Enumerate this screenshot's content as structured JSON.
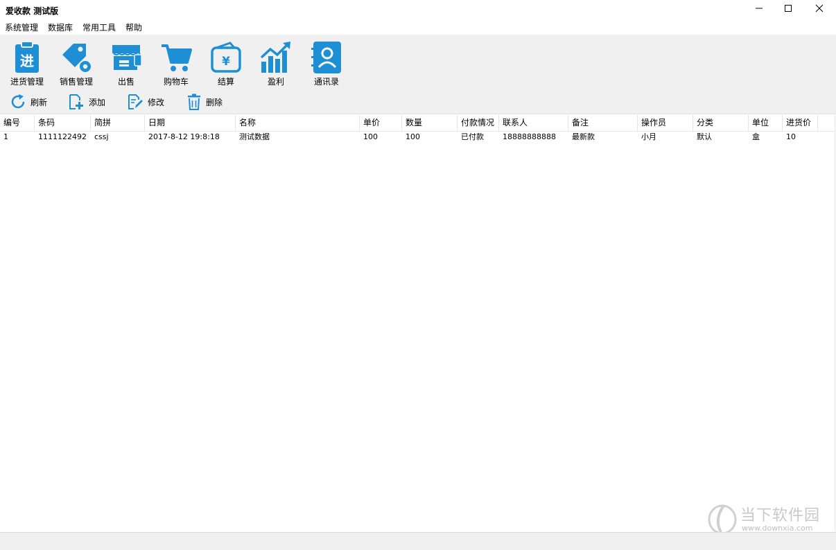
{
  "window": {
    "title": "爱收款 测试版",
    "controls": [
      "minimize",
      "maximize",
      "close"
    ]
  },
  "menu": [
    "系统管理",
    "数据库",
    "常用工具",
    "帮助"
  ],
  "toolbar": {
    "big": [
      {
        "label": "进货管理",
        "icon": "clipboard-jin-icon"
      },
      {
        "label": "销售管理",
        "icon": "price-tag-gear-icon"
      },
      {
        "label": "出售",
        "icon": "storefront-icon"
      },
      {
        "label": "购物车",
        "icon": "shopping-cart-icon"
      },
      {
        "label": "结算",
        "icon": "wallet-yen-icon"
      },
      {
        "label": "盈利",
        "icon": "bar-chart-growth-icon"
      },
      {
        "label": "通讯录",
        "icon": "contacts-book-icon"
      }
    ],
    "small": [
      {
        "label": "刷新",
        "icon": "refresh-icon"
      },
      {
        "label": "添加",
        "icon": "add-document-icon"
      },
      {
        "label": "修改",
        "icon": "edit-document-icon"
      },
      {
        "label": "删除",
        "icon": "trash-icon"
      }
    ],
    "icon_color": "#1e8fd5"
  },
  "table": {
    "columns": [
      "编号",
      "条码",
      "简拼",
      "日期",
      "名称",
      "单价",
      "数量",
      "付款情况",
      "联系人",
      "备注",
      "操作员",
      "分类",
      "单位",
      "进货价"
    ],
    "rows": [
      [
        "1",
        "1111122492",
        "cssj",
        "2017-8-12 19:8:18",
        "测试数据",
        "100",
        "100",
        "已付款",
        "18888888888",
        "最新款",
        "小月",
        "默认",
        "盒",
        "10"
      ]
    ]
  },
  "watermark": {
    "text": "当下软件园",
    "url": "www.downxia.com"
  }
}
